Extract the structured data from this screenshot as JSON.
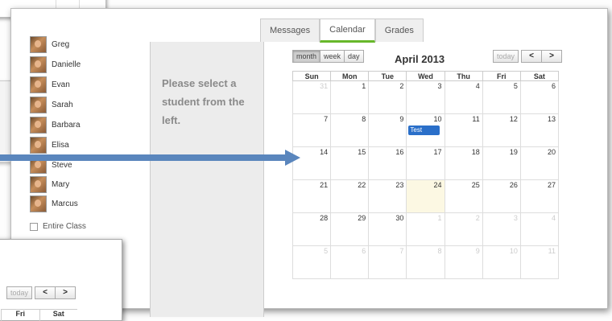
{
  "tabs": [
    {
      "label": "Messages",
      "active": false
    },
    {
      "label": "Calendar",
      "active": true
    },
    {
      "label": "Grades",
      "active": false
    }
  ],
  "students": [
    "Greg",
    "Danielle",
    "Evan",
    "Sarah",
    "Barbara",
    "Elisa",
    "Steve",
    "Mary",
    "Marcus"
  ],
  "entire_class_label": "Entire Class",
  "panel_text": "Please select a student from the left.",
  "calendar": {
    "view_buttons": [
      "month",
      "week",
      "day"
    ],
    "active_view": "month",
    "title": "April 2013",
    "today_label": "today",
    "prev_label": "<",
    "next_label": ">",
    "weekdays": [
      "Sun",
      "Mon",
      "Tue",
      "Wed",
      "Thu",
      "Fri",
      "Sat"
    ],
    "weeks": [
      [
        "31",
        "1",
        "2",
        "3",
        "4",
        "5",
        "6"
      ],
      [
        "7",
        "8",
        "9",
        "10",
        "11",
        "12",
        "13"
      ],
      [
        "14",
        "15",
        "16",
        "17",
        "18",
        "19",
        "20"
      ],
      [
        "21",
        "22",
        "23",
        "24",
        "25",
        "26",
        "27"
      ],
      [
        "28",
        "29",
        "30",
        "1",
        "2",
        "3",
        "4"
      ],
      [
        "5",
        "6",
        "7",
        "8",
        "9",
        "10",
        "11"
      ]
    ],
    "event": {
      "label": "Test Event",
      "date": "10"
    },
    "today_date": "24"
  },
  "front_window": {
    "today_label": "today",
    "prev_label": "<",
    "next_label": ">",
    "weekdays": [
      "Fri",
      "Sat"
    ]
  },
  "colors": {
    "accent_tab": "#67b72a",
    "event": "#2a6fc9",
    "arrow": "#5a86bd",
    "today_bg": "#fcf8e3"
  }
}
